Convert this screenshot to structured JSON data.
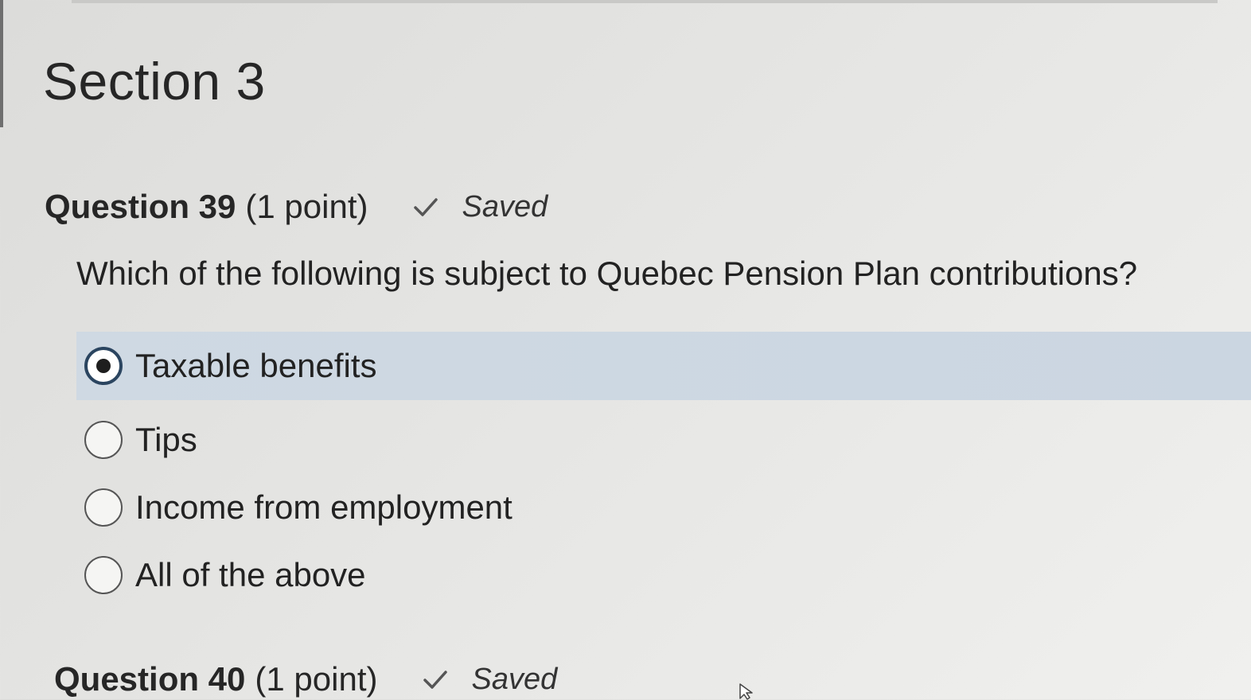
{
  "section": {
    "title": "Section 3"
  },
  "questions": [
    {
      "label": "Question 39",
      "points": "(1 point)",
      "status_icon": "checkmark-icon",
      "status": "Saved",
      "prompt": "Which of the following is subject to Quebec Pension Plan contributions?",
      "options": [
        {
          "label": "Taxable benefits",
          "selected": true
        },
        {
          "label": "Tips",
          "selected": false
        },
        {
          "label": "Income from employment",
          "selected": false
        },
        {
          "label": "All of the above",
          "selected": false
        }
      ]
    },
    {
      "label": "Question 40",
      "points": "(1 point)",
      "status_icon": "checkmark-icon",
      "status": "Saved"
    }
  ],
  "colors": {
    "selected_row": "#cbd6e1",
    "radio_selected_border": "#2b4560",
    "text": "#222222"
  }
}
